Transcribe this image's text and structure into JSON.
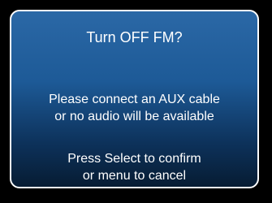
{
  "dialog": {
    "title": "Turn OFF FM?",
    "message_lines": [
      "Please connect an AUX cable",
      "or no audio will be available"
    ],
    "instruction_lines": [
      "Press Select to confirm",
      "or menu to cancel"
    ]
  },
  "colors": {
    "background": "#000000",
    "dialog_top": "#2b68a6",
    "dialog_bottom": "#071c33",
    "border": "#ffffff",
    "text": "#ffffff"
  }
}
